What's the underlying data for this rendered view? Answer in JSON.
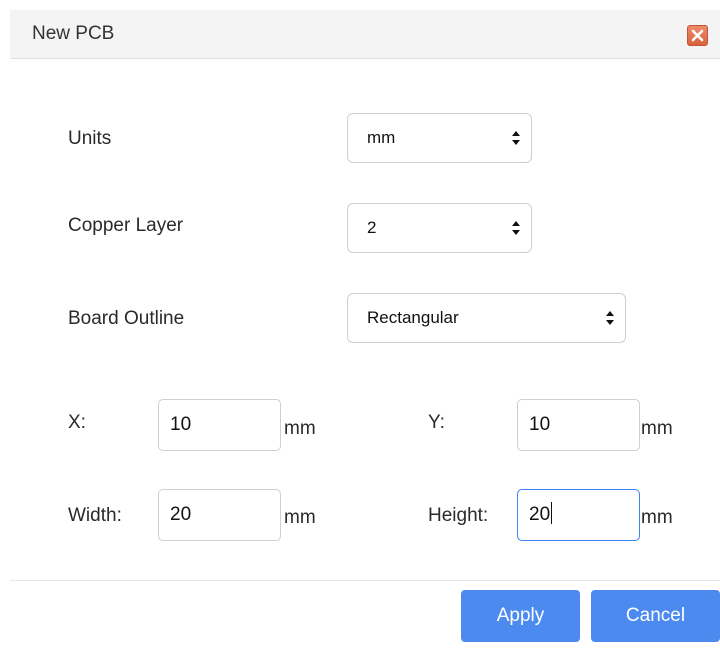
{
  "dialog": {
    "title": "New PCB",
    "close_icon": "close-icon"
  },
  "form": {
    "units": {
      "label": "Units",
      "value": "mm"
    },
    "copper_layer": {
      "label": "Copper Layer",
      "value": "2"
    },
    "board_outline": {
      "label": "Board Outline",
      "value": "Rectangular"
    },
    "x": {
      "label": "X:",
      "value": "10",
      "unit": "mm"
    },
    "y": {
      "label": "Y:",
      "value": "10",
      "unit": "mm"
    },
    "width": {
      "label": "Width:",
      "value": "20",
      "unit": "mm"
    },
    "height": {
      "label": "Height:",
      "value": "20",
      "unit": "mm"
    }
  },
  "buttons": {
    "apply": "Apply",
    "cancel": "Cancel"
  },
  "colors": {
    "primary_button": "#4d8af0",
    "close_button": "#e0704f",
    "focus_border": "#3b82f6"
  }
}
